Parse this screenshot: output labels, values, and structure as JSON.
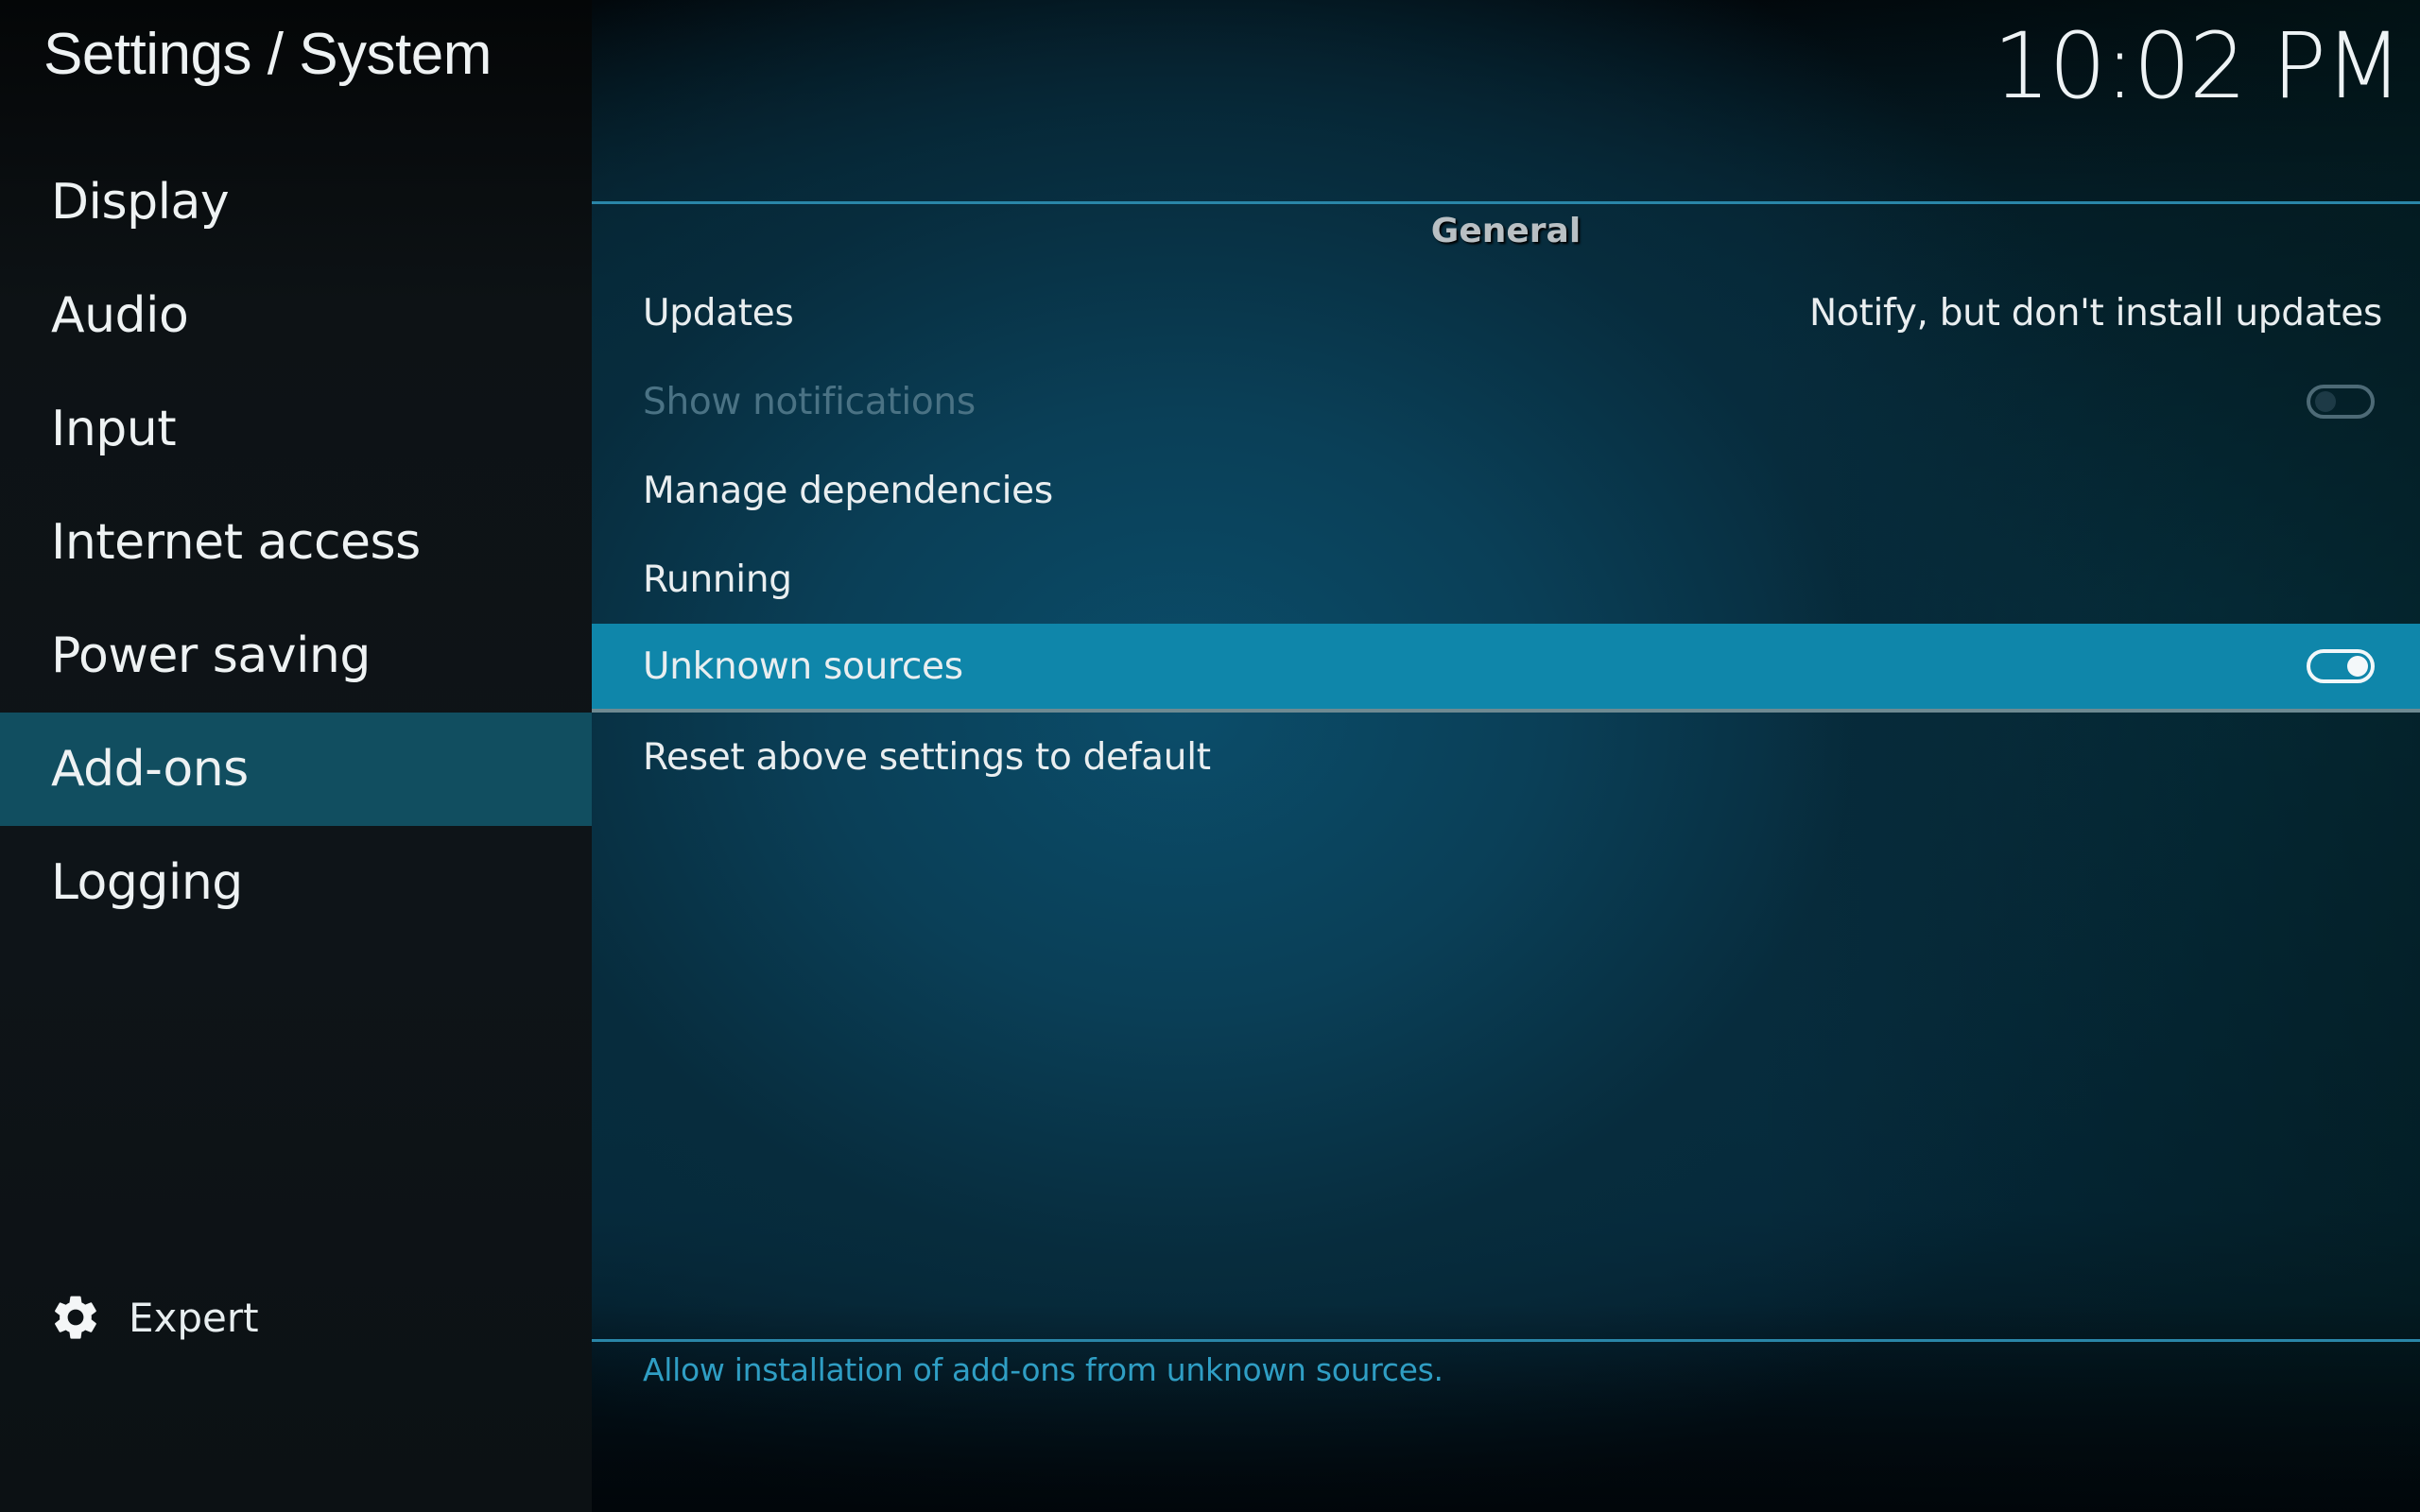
{
  "header": {
    "title": "Settings / System",
    "clock": "10:02 PM"
  },
  "sidebar": {
    "items": [
      {
        "label": "Display",
        "active": false
      },
      {
        "label": "Audio",
        "active": false
      },
      {
        "label": "Input",
        "active": false
      },
      {
        "label": "Internet access",
        "active": false
      },
      {
        "label": "Power saving",
        "active": false
      },
      {
        "label": "Add-ons",
        "active": true
      },
      {
        "label": "Logging",
        "active": false
      }
    ],
    "expert": {
      "label": "Expert",
      "icon": "gear-icon"
    }
  },
  "main": {
    "section_header": "General",
    "rows": [
      {
        "label": "Updates",
        "value": "Notify, but don't install updates"
      },
      {
        "label": "Show notifications",
        "toggle": false,
        "disabled": true
      },
      {
        "label": "Manage dependencies"
      },
      {
        "label": "Running"
      },
      {
        "label": "Unknown sources",
        "toggle": true,
        "focused": true
      },
      {
        "label": "Reset above settings to default"
      }
    ],
    "description": "Allow installation of add-ons from unknown sources."
  },
  "colors": {
    "accent": "#0f86aa",
    "sidebar_active": "#114e60",
    "rule": "#2a86a8",
    "description_text": "#2f9ec4"
  }
}
